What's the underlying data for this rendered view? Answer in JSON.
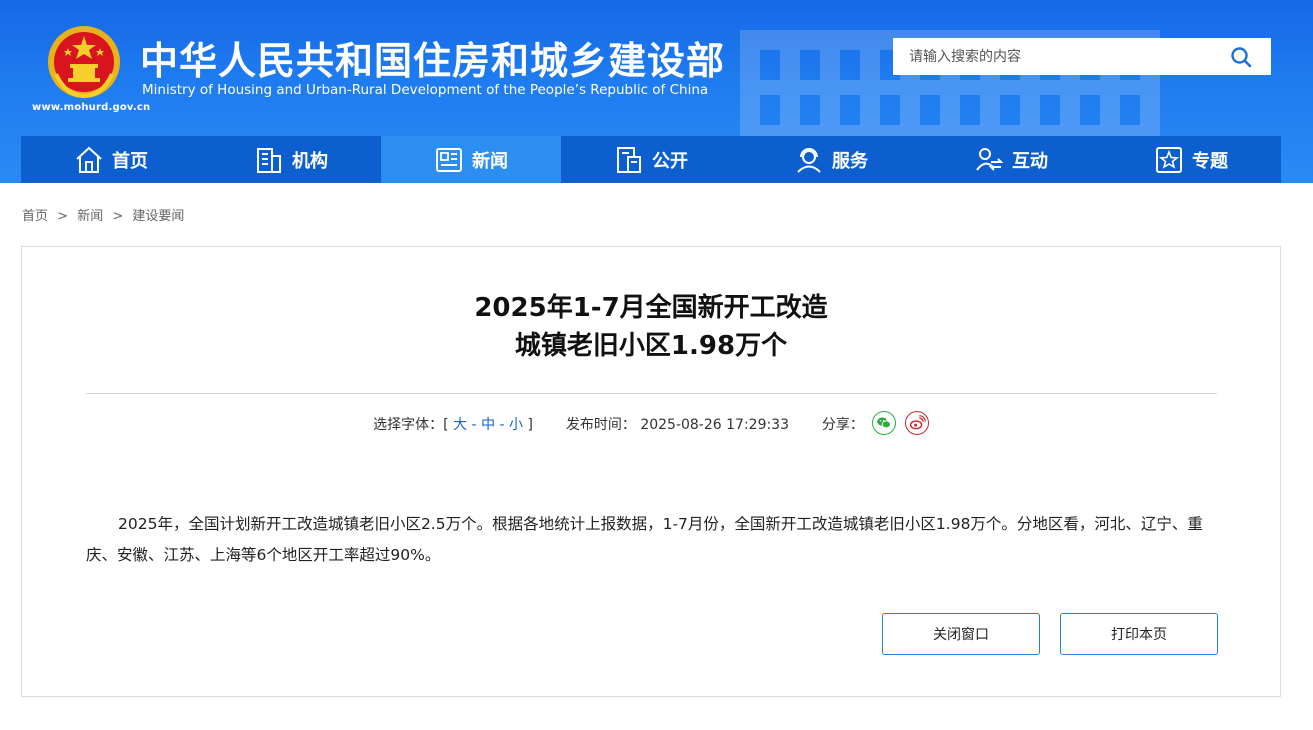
{
  "header": {
    "title_cn": "中华人民共和国住房和城乡建设部",
    "title_en": "Ministry of Housing and Urban-Rural Development of the People’s Republic of China",
    "site_url": "www.mohurd.gov.cn",
    "emblem_icon": "national-emblem-icon",
    "search": {
      "placeholder": "请输入搜索的内容",
      "icon": "search-icon"
    },
    "colors": {
      "header_blue": "#1f7cf0",
      "nav_blue": "#0d5fd0",
      "nav_active": "#2d8ef2"
    }
  },
  "nav": {
    "items": [
      {
        "label": "首页",
        "icon": "home-icon"
      },
      {
        "label": "机构",
        "icon": "building-icon"
      },
      {
        "label": "新闻",
        "icon": "newspaper-icon",
        "active": true
      },
      {
        "label": "公开",
        "icon": "document-icon"
      },
      {
        "label": "服务",
        "icon": "service-icon"
      },
      {
        "label": "互动",
        "icon": "interaction-icon"
      },
      {
        "label": "专题",
        "icon": "star-icon"
      }
    ]
  },
  "breadcrumb": {
    "items": [
      "首页",
      "新闻",
      "建设要闻"
    ],
    "separator": ">"
  },
  "article": {
    "title_line1": "2025年1-7月全国新开工改造",
    "title_line2": "城镇老旧小区1.98万个",
    "meta": {
      "font_label": "选择字体：[",
      "font_large": "大",
      "font_medium": "中",
      "font_small": "小",
      "font_dash": "-",
      "font_close": "]",
      "publish_label": "发布时间：",
      "publish_time": "2025-08-26 17:29:33",
      "share_label": "分享："
    },
    "body": "2025年，全国计划新开工改造城镇老旧小区2.5万个。根据各地统计上报数据，1-7月份，全国新开工改造城镇老旧小区1.98万个。分地区看，河北、辽宁、重庆、安徽、江苏、上海等6个地区开工率超过90%。",
    "buttons": {
      "close": "关闭窗口",
      "print": "打印本页"
    }
  }
}
